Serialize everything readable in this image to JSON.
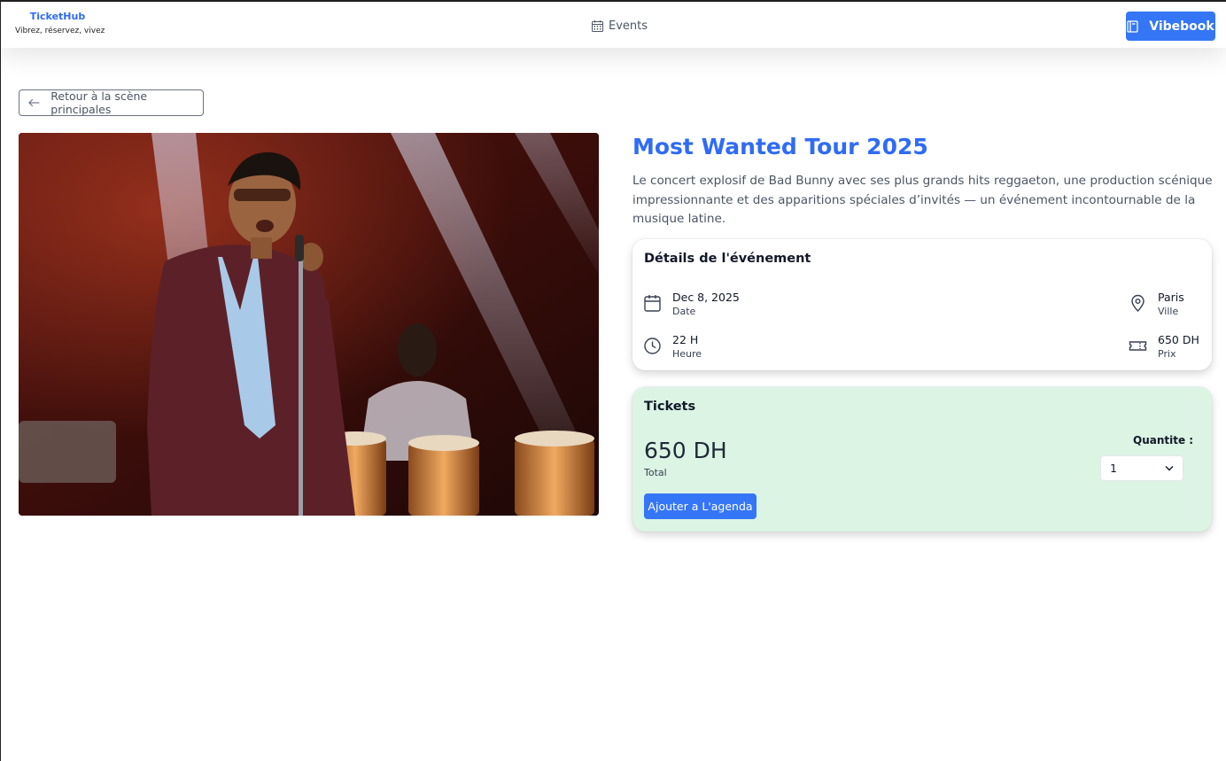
{
  "brand": {
    "name": "TicketHub",
    "tagline": "Vibrez, réservez, vivez"
  },
  "nav": {
    "events_label": "Events",
    "vibebook_label": "Vibebook"
  },
  "back": {
    "label": "Retour à la scène principales"
  },
  "event": {
    "title": "Most Wanted Tour 2025",
    "description": "Le concert explosif de Bad Bunny avec ses plus grands hits reggaeton, une production scénique impressionnante et des apparitions spéciales d’invités — un événement incontournable de la musique latine."
  },
  "details": {
    "title": "Détails de l'événement",
    "date": {
      "value": "Dec 8, 2025",
      "label": "Date",
      "icon": "calendar-icon"
    },
    "time": {
      "value": "22 H",
      "label": "Heure",
      "icon": "clock-icon"
    },
    "city": {
      "value": "Paris",
      "label": "Ville",
      "icon": "map-pin-icon"
    },
    "price": {
      "value": "650 DH",
      "label": "Prix",
      "icon": "ticket-icon"
    }
  },
  "tickets": {
    "title": "Tickets",
    "total_value": "650 DH",
    "total_label": "Total",
    "quantity_label": "Quantite :",
    "quantity_value": "1",
    "add_label": "Ajouter a L'agenda"
  },
  "colors": {
    "accent": "#3476f6",
    "title": "#2f6bf6",
    "tickets_bg": "#dcf4e4"
  }
}
